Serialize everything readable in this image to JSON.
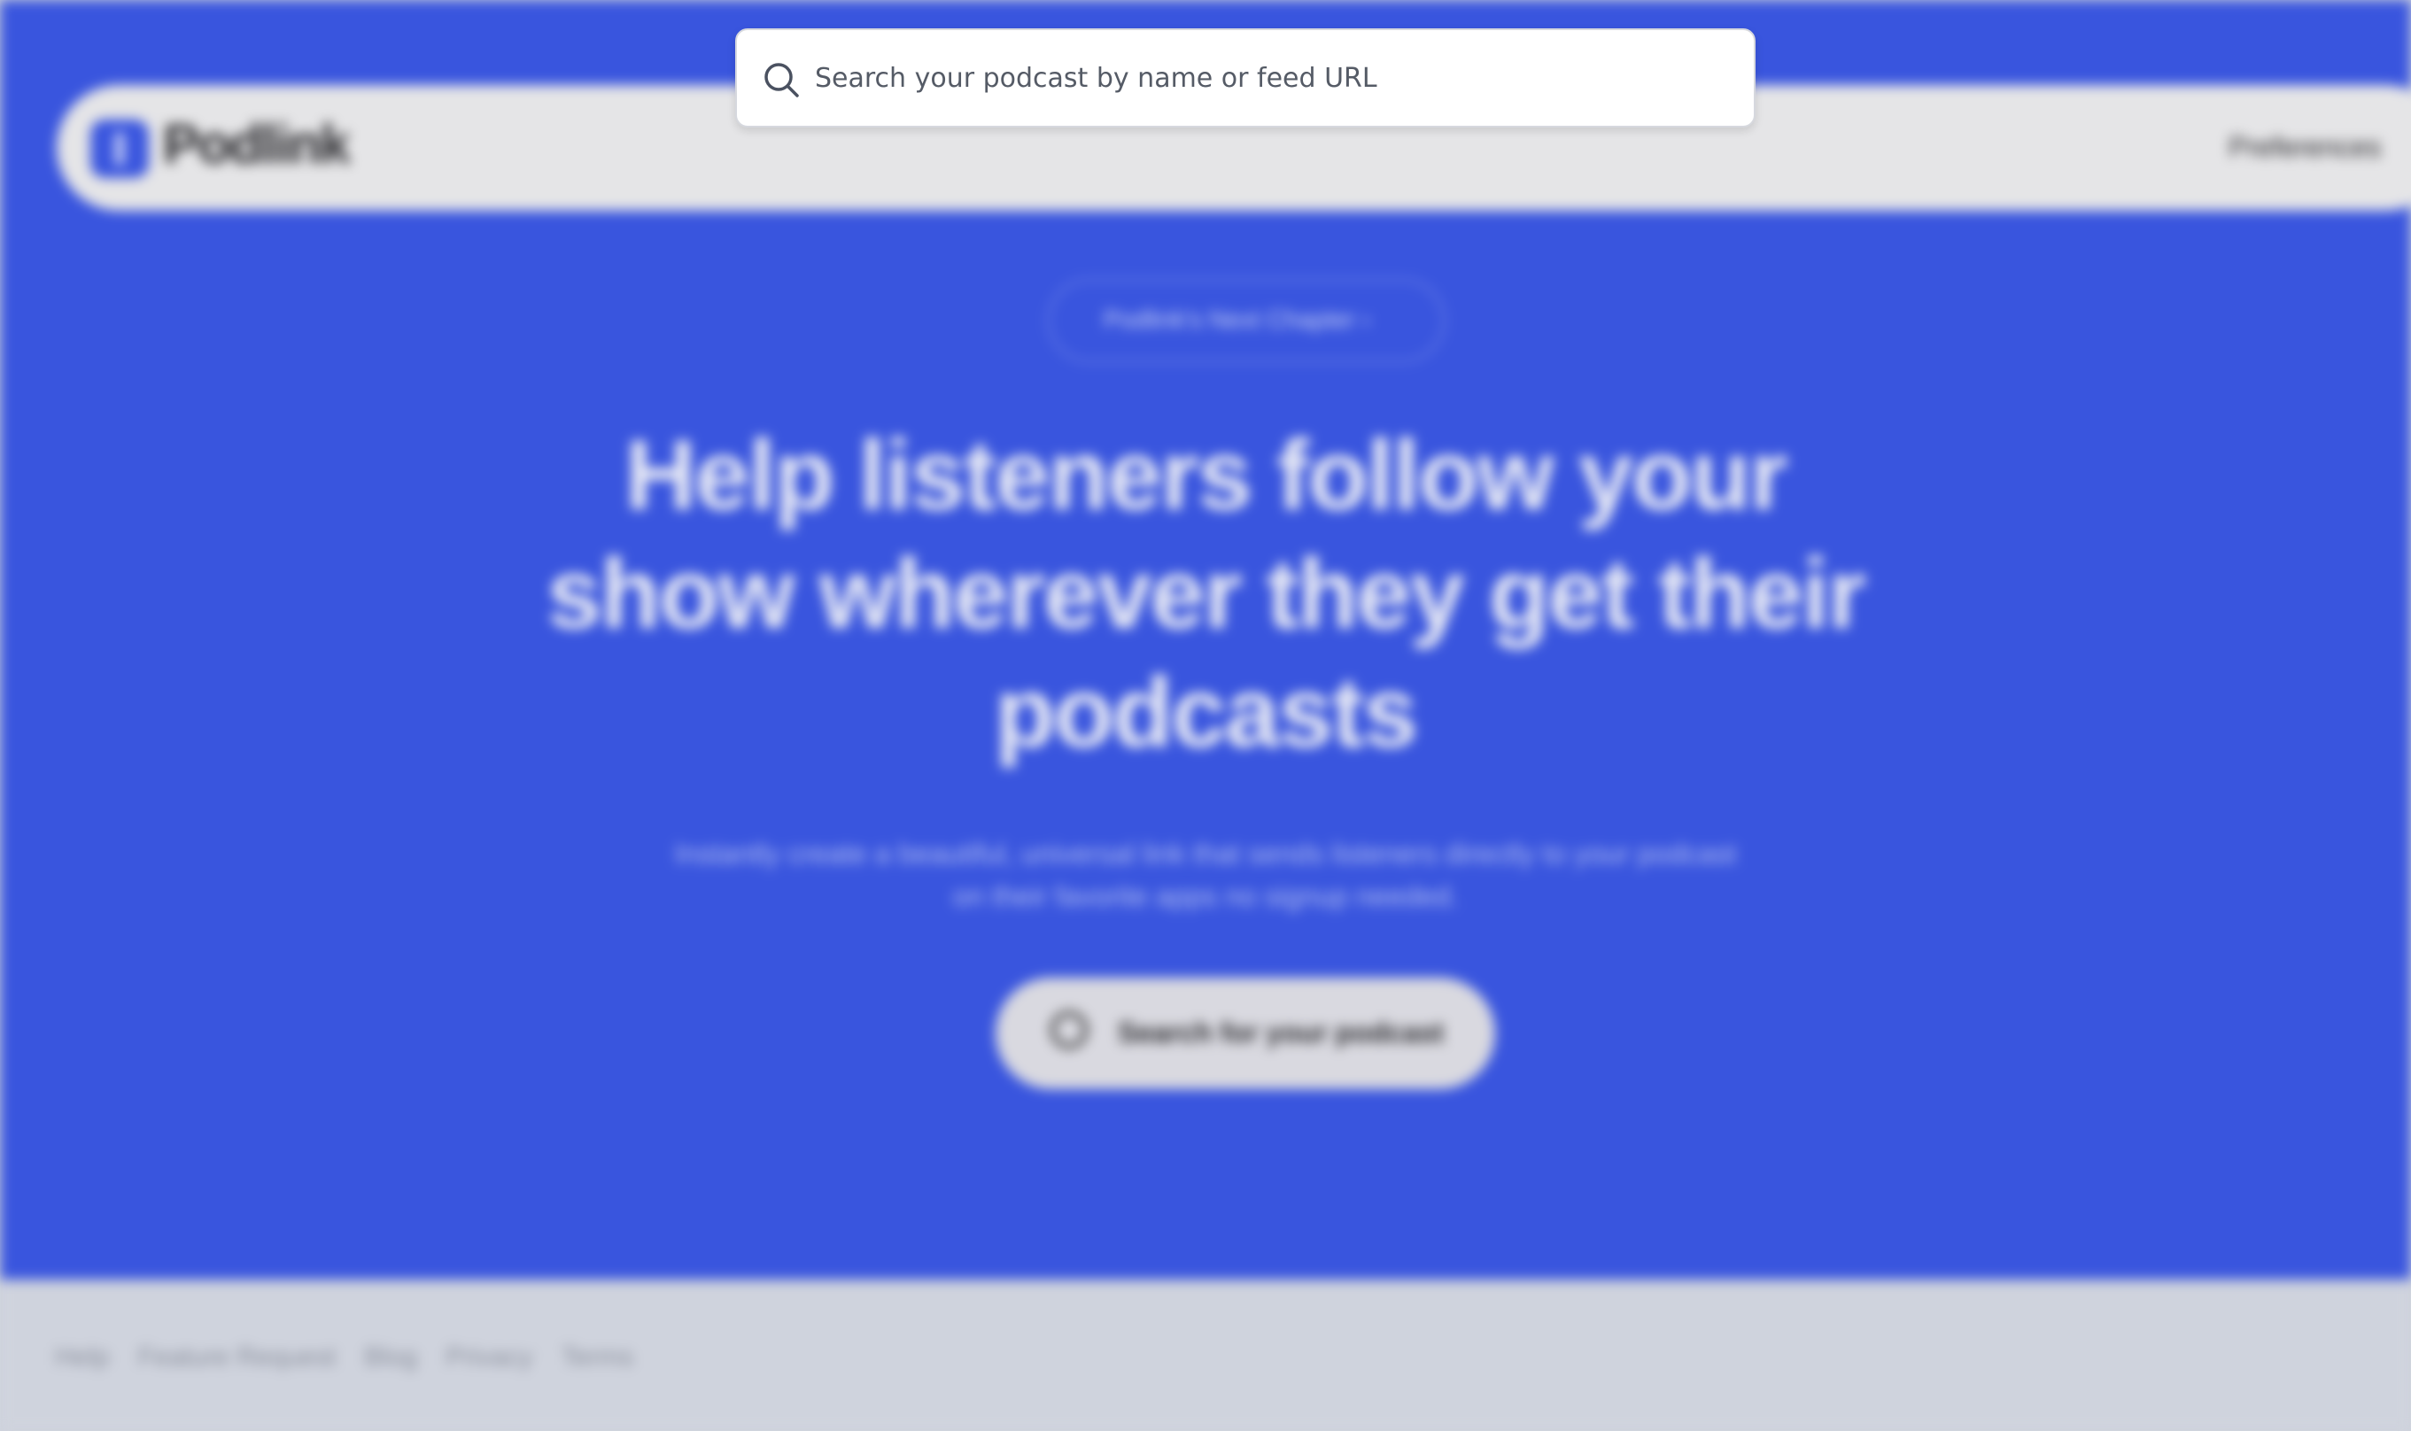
{
  "header": {
    "logo_text": "Podlink",
    "preferences_label": "Preferences"
  },
  "hero": {
    "chapter_label": "Podlink's Next Chapter ›",
    "headline": "Help listeners follow your show wherever they get their podcasts",
    "subtext": "Instantly create a beautiful, universal link that sends listeners directly to your podcast on their favorite apps no signup needed.",
    "cta_label": "Search for your podcast"
  },
  "footer": {
    "links": [
      "Help",
      "Feature Request",
      "Blog",
      "Privacy",
      "Terms"
    ]
  },
  "search": {
    "placeholder": "Search your podcast by name or feed URL",
    "value": ""
  },
  "colors": {
    "hero_bg": "#3955de",
    "footer_bg": "#cfd3dd",
    "search_bg": "#ffffff"
  }
}
